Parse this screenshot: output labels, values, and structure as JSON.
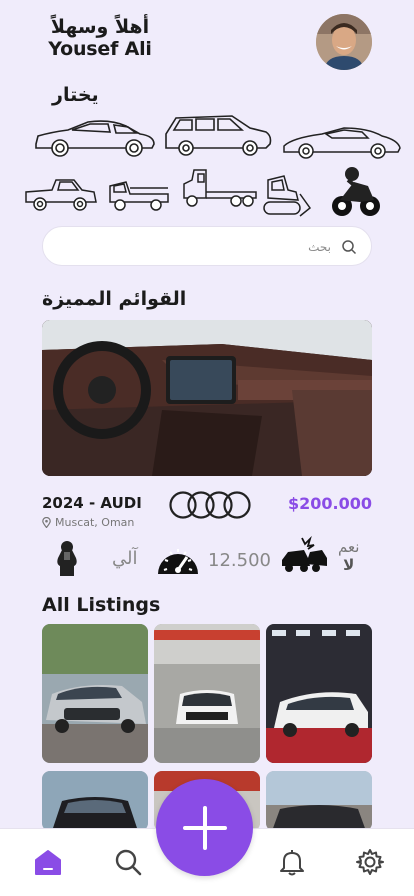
{
  "header": {
    "greeting": "أهلاً وسهلاً",
    "user_name": "Yousef Ali"
  },
  "choose_label": "يختار",
  "vehicle_types": [
    {
      "name": "sedan-icon"
    },
    {
      "name": "suv-icon"
    },
    {
      "name": "sports-car-icon"
    },
    {
      "name": "pickup-truck-icon"
    },
    {
      "name": "flatbed-truck-icon"
    },
    {
      "name": "semi-truck-icon"
    },
    {
      "name": "bulldozer-icon"
    },
    {
      "name": "motorcycle-icon"
    }
  ],
  "search": {
    "placeholder": "بحث",
    "value": ""
  },
  "featured": {
    "section_title": "القوائم المميزة",
    "title": "2024 - AUDI",
    "location": "Muscat, Oman",
    "price": "$200.000",
    "transmission": "آلي",
    "mileage": "12.500",
    "accident_yes": "نعم",
    "accident_no": "لا"
  },
  "all_listings": {
    "section_title": "All Listings"
  },
  "colors": {
    "accent": "#8a4ce6",
    "background": "#f0ecfb"
  }
}
